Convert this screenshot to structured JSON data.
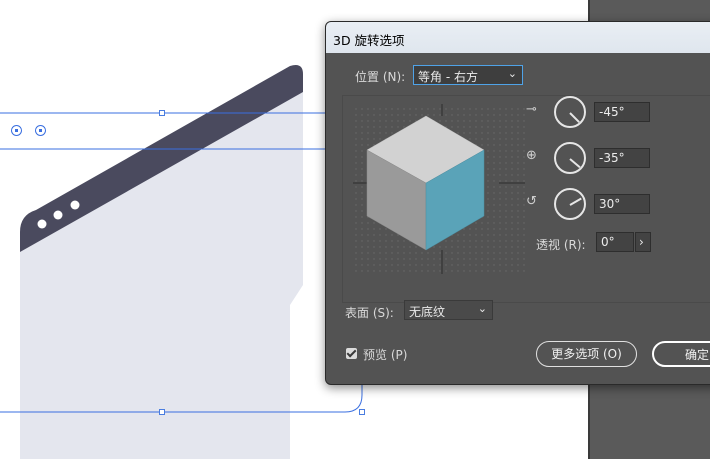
{
  "dialog": {
    "title": "3D 旋转选项",
    "position_label": "位置 (N):",
    "position_value": "等角 - 右方",
    "x_rotation": "-45°",
    "y_rotation": "-35°",
    "z_rotation": "30°",
    "perspective_label": "透视 (R):",
    "perspective_value": "0°",
    "surface_label": "表面 (S):",
    "surface_value": "无底纹",
    "preview_label": "预览 (P)",
    "preview_checked": true,
    "more_options_label": "更多选项 (O)",
    "ok_label": "确定"
  },
  "colors": {
    "cube_top": "#d2d2d2",
    "cube_left": "#9a9a9a",
    "cube_right": "#5aa3b8",
    "window_frame": "#4a4a5e",
    "window_body": "#e4e6ee",
    "selection": "#3a6fe0"
  },
  "icons": {
    "x_axis": "rotate-x-icon",
    "y_axis": "rotate-y-icon",
    "z_axis": "rotate-z-icon",
    "dropdown": "chevron-down-icon",
    "stepper": "chevron-right-icon"
  }
}
